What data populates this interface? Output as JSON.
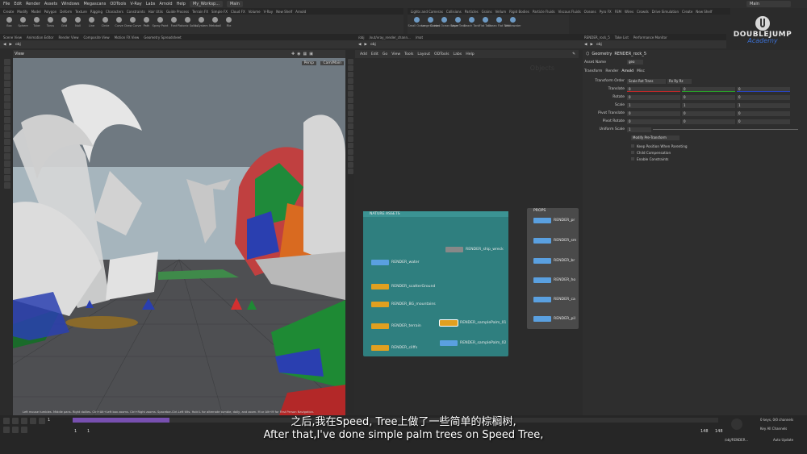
{
  "menubar": {
    "items": [
      "File",
      "Edit",
      "Render",
      "Assets",
      "Windows",
      "Megascans",
      "ODTools",
      "V-Ray",
      "Labs",
      "Arnold",
      "Help"
    ],
    "desktop": "My_Worksp...",
    "workspace": "Main",
    "main_right": "Main"
  },
  "shelf_tabs": [
    "Create",
    "Modify",
    "Model",
    "Polygon",
    "Deform",
    "Texture",
    "Rigging",
    "Characters",
    "Constraints",
    "Hair Utils",
    "Guide Process",
    "Terrain FX",
    "Simple FX",
    "Cloud FX",
    "Volume",
    "V-Ray",
    "New Shelf",
    "Arnold"
  ],
  "shelf_tabs_right": [
    "Lights and Cameras",
    "Collisions",
    "Particles",
    "Grains",
    "Vellum",
    "Rigid Bodies",
    "Particle Fluids",
    "Viscous Fluids",
    "Oceans",
    "Pyro FX",
    "FEM",
    "Wires",
    "Crowds",
    "Drive Simulation",
    "Create",
    "New Shelf"
  ],
  "tools": [
    "Box",
    "Sphere",
    "Tube",
    "Torus",
    "Grid",
    "Null",
    "Line",
    "Circle",
    "Curve",
    "Draw Curve",
    "Path",
    "Spray Paint",
    "Font",
    "Platonic Solids",
    "L-System",
    "Metaball",
    "File"
  ],
  "tools_right": [
    "Small Ocean",
    "Large Ocean",
    "Guided Ocean Layer",
    "Wave Tank",
    "Beach Tank",
    "Flat Tank",
    "Ocean Flat Tank",
    "Whitewater"
  ],
  "viewport": {
    "tabs": [
      "Scene View",
      "Animation Editor",
      "Render View",
      "Composite View",
      "Motion FX View",
      "Geometry Spreadsheet"
    ],
    "path": "obj",
    "label": "View",
    "persp": "Persp",
    "cam": "Cam/Main",
    "hint": "Left mouse tumbles. Middle pans. Right dollies. Ctrl+Alt+Left box zooms. Ctrl+Right zooms. Spacebar-Ctrl-Left tilts. Hold L for alternate tumble, dolly, and zoom.    M or Alt+M for First Person Navigation."
  },
  "network": {
    "tabs": [
      "/obj",
      "/out/vray_render_chann...",
      "/mat"
    ],
    "path": "obj",
    "menu": [
      "Add",
      "Edit",
      "Go",
      "View",
      "Tools",
      "Layout",
      "ODTools",
      "Labs",
      "Help"
    ],
    "watermark": "Objects"
  },
  "nature_assets": {
    "title": "NATURE ASSETS",
    "nodes": [
      "RENDER_water",
      "RENDER_scatterGround",
      "RENDER_BG_mountains",
      "RENDER_terrain",
      "RENDER_cliffs",
      "RENDER_ship_wreck",
      "RENDER_samplePalm_01",
      "RENDER_samplePalm_02"
    ],
    "accent": "#2f7f7f"
  },
  "props": {
    "title": "PROPS",
    "nodes": [
      "RENDER_pr",
      "RENDER_sm",
      "RENDER_br",
      "RENDER_ho",
      "RENDER_ca",
      "RENDER_pil"
    ],
    "sub": [
      "geo",
      "geo",
      "Subnetwork",
      "Subnetwork",
      "geo",
      "geo"
    ]
  },
  "params": {
    "tabs": [
      "RENDER_rock_5",
      "Take List",
      "Performance Monitor"
    ],
    "path": "obj",
    "type": "Geometry",
    "name": "RENDER_rock_5",
    "asset_label": "Asset Name",
    "asset_value": "geo",
    "ptabs": [
      "Transform",
      "Render",
      "Arnold",
      "Misc"
    ],
    "transform_order_label": "Transform Order",
    "transform_order": "Scale Rot Trans",
    "rot_order": "Rx Ry Rz",
    "rows": [
      {
        "label": "Translate",
        "v": [
          "0",
          "0",
          "0"
        ]
      },
      {
        "label": "Rotate",
        "v": [
          "0",
          "0",
          "0"
        ]
      },
      {
        "label": "Scale",
        "v": [
          "1",
          "1",
          "1"
        ]
      },
      {
        "label": "Pivot Translate",
        "v": [
          "0",
          "0",
          "0"
        ]
      },
      {
        "label": "Pivot Rotate",
        "v": [
          "0",
          "0",
          "0"
        ]
      },
      {
        "label": "Uniform Scale",
        "v": [
          "1"
        ]
      }
    ],
    "modify_label": "Modify Pre-Transform",
    "checks": [
      "Keep Position When Parenting",
      "Child Compensation",
      "Enable Constraints"
    ]
  },
  "logo": {
    "line1": "DOUBLEJUMP",
    "line2": "Academy"
  },
  "timeline": {
    "frame": "1",
    "start": "1",
    "end": "1",
    "r1": "148",
    "r2": "148",
    "keys": "0 keys, 0/0 channels",
    "keyall": "Key All Channels",
    "path": "/obj/RENDER...",
    "autoupdate": "Auto Update"
  },
  "subtitles": {
    "cn": "之后,我在Speed, Tree上做了一些简单的棕榈树,",
    "en": "After that,I've done simple palm trees on Speed Tree,"
  }
}
